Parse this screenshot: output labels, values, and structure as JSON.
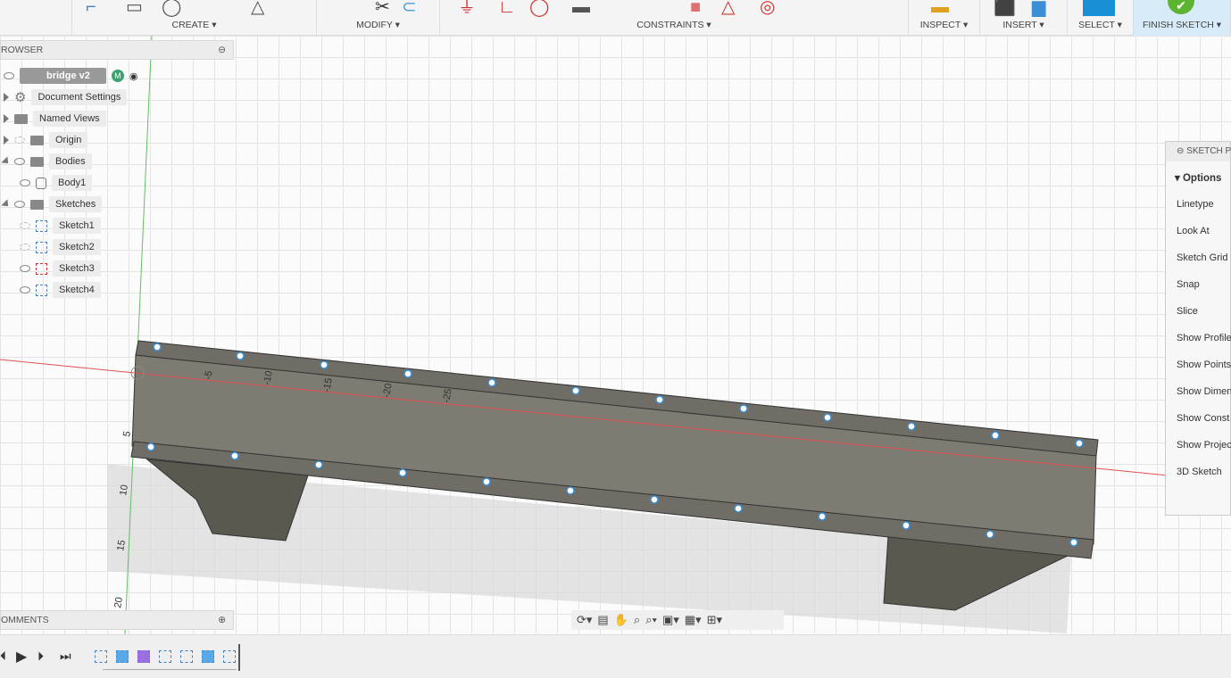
{
  "toolbar": {
    "groups": [
      {
        "label": "CREATE ▾"
      },
      {
        "label": "MODIFY ▾"
      },
      {
        "label": "CONSTRAINTS ▾"
      },
      {
        "label": "INSPECT ▾"
      },
      {
        "label": "INSERT ▾"
      },
      {
        "label": "SELECT ▾"
      },
      {
        "label": "FINISH SKETCH ▾"
      }
    ],
    "finish_color": "#5bb531",
    "select_color": "#1b8fd6"
  },
  "browser": {
    "title": "ROWSER",
    "root": "bridge v2",
    "items": [
      {
        "label": "Document Settings"
      },
      {
        "label": "Named Views"
      },
      {
        "label": "Origin"
      },
      {
        "label": "Bodies"
      },
      {
        "label": "Body1"
      },
      {
        "label": "Sketches"
      },
      {
        "label": "Sketch1"
      },
      {
        "label": "Sketch2"
      },
      {
        "label": "Sketch3"
      },
      {
        "label": "Sketch4"
      }
    ]
  },
  "palette": {
    "title": "SKETCH P",
    "section": "Options",
    "items": [
      "Linetype",
      "Look At",
      "Sketch Grid",
      "Snap",
      "Slice",
      "Show Profile",
      "Show Points",
      "Show Dimen",
      "Show Const",
      "Show Projec",
      "3D Sketch"
    ]
  },
  "comments": {
    "title": "OMMENTS"
  },
  "ruler": {
    "x_ticks": [
      "-5",
      "-10",
      "-15",
      "-20",
      "-25"
    ],
    "y_ticks": [
      "5",
      "10",
      "15",
      "20"
    ]
  },
  "colors": {
    "x_axis": "#e05050",
    "y_axis": "#60c060",
    "body": "#7d7b72"
  }
}
